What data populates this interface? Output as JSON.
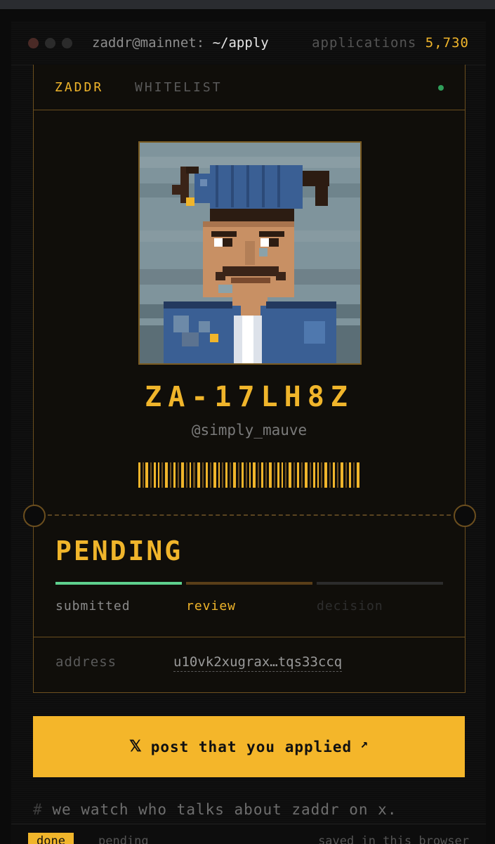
{
  "window": {
    "path_host": "zaddr@mainnet:",
    "path_dir": "~/apply",
    "applications_label": "applications",
    "applications_count": "5,730"
  },
  "card": {
    "brand": "ZADDR",
    "tab": "WHITELIST",
    "code": "ZA-17LH8Z",
    "handle": "@simply_mauve",
    "status": "PENDING",
    "progress": {
      "steps": [
        "submitted",
        "review",
        "decision"
      ],
      "current_step": 1
    },
    "address_label": "address",
    "address_value": "u10vk2xugrax…tqs33ccq"
  },
  "cta": {
    "label": "post that you applied"
  },
  "comment": {
    "hash": "#",
    "text": "we watch who talks about zaddr on x."
  },
  "footer": {
    "done_label": "done",
    "pending_label": "pending",
    "saved_text": "saved in this browser"
  },
  "colors": {
    "accent": "#f0b52b",
    "cta": "#f4b62a",
    "complete": "#5ed08e",
    "border": "#6b4e1e"
  },
  "icons": {
    "cta_logo": "x-logo-icon",
    "cta_arrow": "arrow-up-right-icon",
    "live": "status-dot-icon"
  }
}
